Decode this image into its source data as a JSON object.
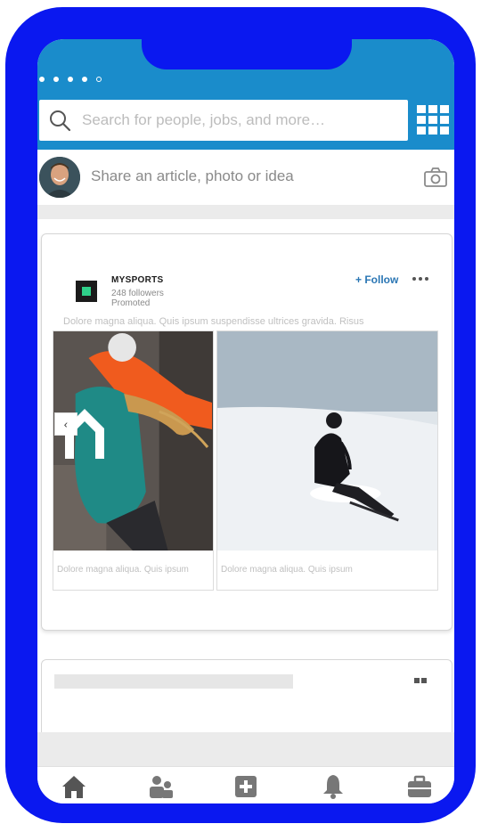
{
  "search": {
    "placeholder": "Search for people, jobs, and more…"
  },
  "share": {
    "prompt": "Share an article, photo or idea"
  },
  "post": {
    "company_name": "MYSPORTS",
    "followers": "248 followers",
    "promoted_label": "Promoted",
    "follow_label": "+ Follow",
    "text": "Dolore magna aliqua. Quis ipsum suspendisse ultrices gravida. Risus",
    "slides": [
      {
        "caption": "Dolore magna aliqua. Quis ipsum"
      },
      {
        "caption": "Dolore magna aliqua. Quis ipsum"
      }
    ],
    "prev_symbol": "‹"
  },
  "colors": {
    "frame": "#0a18f0",
    "header": "#1a8ccb",
    "follow": "#2a76b4",
    "nav_icon": "#555555"
  },
  "icons": {
    "search": "search-icon",
    "apps": "grid-icon",
    "camera": "camera-icon",
    "more": "more-icon",
    "nav": [
      "home-icon",
      "people-icon",
      "add-post-icon",
      "notifications-icon",
      "jobs-icon"
    ]
  }
}
